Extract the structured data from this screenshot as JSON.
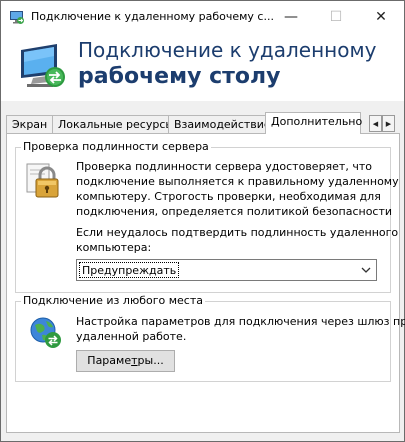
{
  "window": {
    "title": "Подключение к удаленному рабочему с...",
    "minimize_glyph": "—",
    "maximize_glyph": "☐",
    "close_glyph": "✕"
  },
  "banner": {
    "line1": "Подключение к удаленному",
    "line2": "рабочему столу"
  },
  "tabs": [
    {
      "label": "Экран",
      "active": false
    },
    {
      "label": "Локальные ресурсы",
      "active": false
    },
    {
      "label": "Взаимодействие",
      "active": false
    },
    {
      "label": "Дополнительно",
      "active": true
    }
  ],
  "tab_scroll": {
    "left": "◀",
    "right": "▶"
  },
  "server_auth": {
    "legend": "Проверка подлинности сервера",
    "description": [
      "Проверка подлинности сервера удостоверяет, что",
      "подключение выполняется к правильному удаленному",
      "компьютеру. Строгость проверки, необходимая для",
      "подключения, определяется политикой безопасности"
    ],
    "question": [
      "Если неудалось подтвердить подлинность удаленного",
      "компьютера:"
    ],
    "dropdown_value": "Предупреждать"
  },
  "remote_access": {
    "legend": "Подключение из любого места",
    "description": [
      "Настройка параметров для подключения через шлюз при",
      "удаленной работе."
    ],
    "button_prefix": "Параме",
    "button_mnemonic": "т",
    "button_suffix": "ры..."
  },
  "icons": {
    "app": "remote-desktop-icon",
    "banner": "remote-desktop-monitor-icon",
    "lock": "padlock-icon",
    "globe": "globe-connection-icon",
    "chevron": "chevron-down-icon"
  },
  "colors": {
    "banner_text": "#1c3d6e",
    "panel_bg": "#ffffff",
    "window_bg": "#f0f0f0",
    "button_bg": "#e1e1e1"
  }
}
